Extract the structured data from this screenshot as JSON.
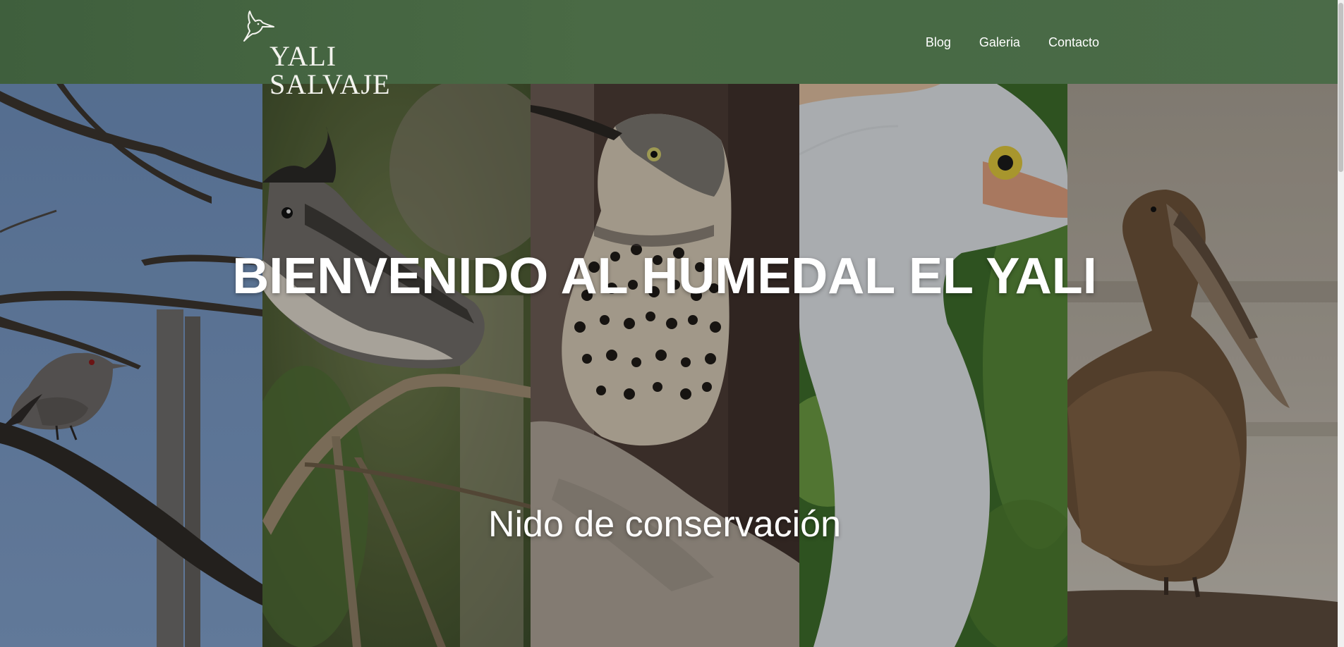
{
  "header": {
    "logo_text": "YALI SALVAJE",
    "logo_icon": "hummingbird-icon",
    "nav": [
      {
        "label": "Blog"
      },
      {
        "label": "Galeria"
      },
      {
        "label": "Contacto"
      }
    ]
  },
  "hero": {
    "title": "BIENVENIDO AL HUMEDAL EL YALI",
    "subtitle": "Nido de conservación",
    "panels": [
      {
        "subject": "gray-bird-on-branch"
      },
      {
        "subject": "crested-tit-on-branch"
      },
      {
        "subject": "woodpecker-on-rock"
      },
      {
        "subject": "white-egret"
      },
      {
        "subject": "brown-pelican"
      }
    ]
  },
  "colors": {
    "header_bg": "#45653f",
    "text": "#ffffff"
  }
}
